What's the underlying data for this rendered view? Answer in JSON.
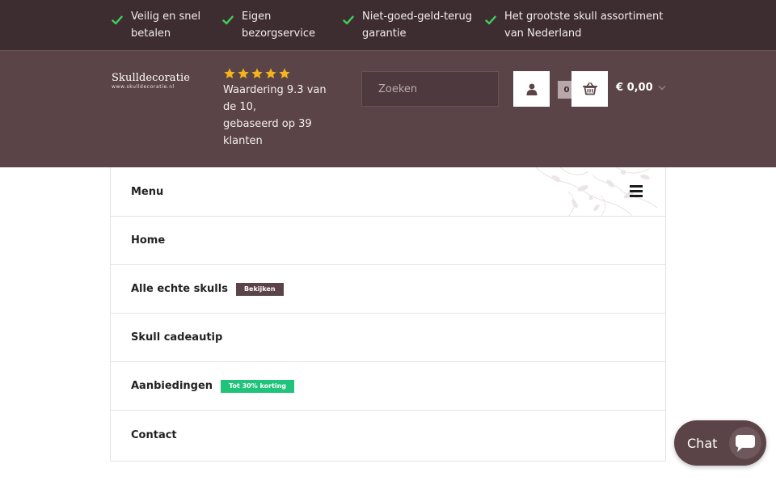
{
  "usps": [
    {
      "text": "Veilig en snel betalen"
    },
    {
      "text": "Eigen bezorgservice"
    },
    {
      "text": "Niet-goed-geld-terug garantie"
    },
    {
      "text": "Het grootste skull assortiment van Nederland"
    }
  ],
  "logo": {
    "name": "Skulldecoratie",
    "url": "www.skulldecoratie.nl"
  },
  "rating": {
    "stars": 5,
    "line1": "Waardering 9.3 van de 10,",
    "line2": "gebaseerd op 39 klanten"
  },
  "search": {
    "placeholder": "Zoeken"
  },
  "cart": {
    "count": "0",
    "total": "€ 0,00"
  },
  "menu": {
    "header": "Menu",
    "items": [
      {
        "label": "Home",
        "badge": ""
      },
      {
        "label": "Alle echte skulls",
        "badge": "Bekijken"
      },
      {
        "label": "Skull cadeautip",
        "badge": ""
      },
      {
        "label": "Aanbiedingen",
        "badge": "Tot 30% korting"
      },
      {
        "label": "Contact",
        "badge": ""
      }
    ]
  },
  "chat": {
    "label": "Chat"
  },
  "colors": {
    "top_bar": "#3e2d30",
    "header": "#5b4448",
    "check": "#3fcf5a",
    "star": "#f5b41a",
    "badge_green": "#1fc37a"
  },
  "icons": {
    "check": "check-icon",
    "star": "star-icon",
    "search": "search-icon",
    "account": "user-icon",
    "cart": "basket-icon",
    "chevron": "chevron-down-icon",
    "menu": "hamburger-icon",
    "chat": "chat-bubble-icon"
  }
}
